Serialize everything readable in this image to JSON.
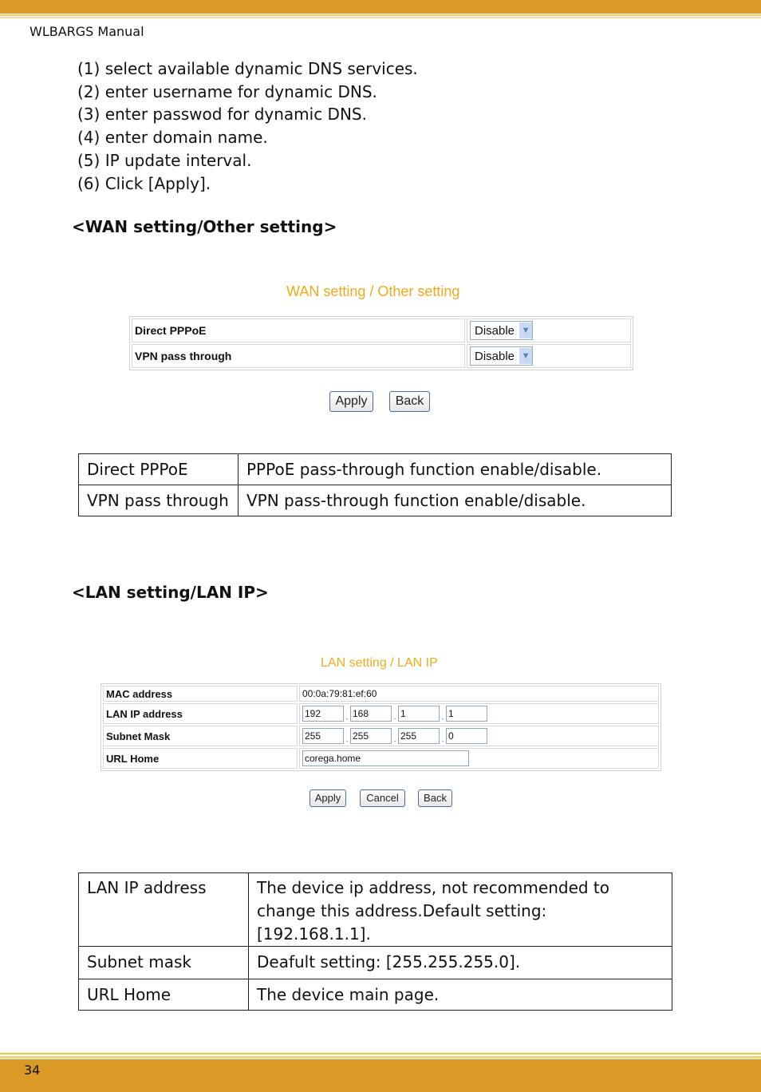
{
  "header": {
    "title": "WLBARGS Manual"
  },
  "steps": [
    "(1) select available dynamic DNS services.",
    "(2) enter username for dynamic DNS.",
    "(3) enter passwod for dynamic DNS.",
    "(4) enter domain name.",
    "(5) IP update interval.",
    "(6) Click [Apply]."
  ],
  "wan_section": {
    "heading": "<WAN setting/Other setting>",
    "screenshot": {
      "title": "WAN setting / Other setting",
      "rows": [
        {
          "label": "Direct PPPoE",
          "value": "Disable"
        },
        {
          "label": "VPN pass through",
          "value": "Disable"
        }
      ],
      "buttons": {
        "apply": "Apply",
        "back": "Back"
      }
    },
    "description_table": [
      {
        "term": "Direct PPPoE",
        "desc": "PPPoE pass-through function enable/disable."
      },
      {
        "term": "VPN pass through",
        "desc": "VPN pass-through function enable/disable."
      }
    ]
  },
  "lan_section": {
    "heading": "<LAN setting/LAN IP>",
    "screenshot": {
      "title": "LAN setting / LAN IP",
      "mac_label": "MAC address",
      "mac_value": "00:0a:79:81:ef:60",
      "ip_label": "LAN IP address",
      "ip_octets": [
        "192",
        "168",
        "1",
        "1"
      ],
      "mask_label": "Subnet Mask",
      "mask_octets": [
        "255",
        "255",
        "255",
        "0"
      ],
      "url_label": "URL Home",
      "url_value": "corega.home",
      "buttons": {
        "apply": "Apply",
        "cancel": "Cancel",
        "back": "Back"
      }
    },
    "description_table": [
      {
        "term": "LAN IP address",
        "desc_line1": "The device ip address, not recommended to",
        "desc_line2": "change this address.Default setting: [192.168.1.1]."
      },
      {
        "term": "Subnet mask",
        "desc": "Deafult setting: [255.255.255.0]."
      },
      {
        "term": "URL Home",
        "desc": "The device main page."
      }
    ]
  },
  "footer": {
    "page_number": "34"
  },
  "colors": {
    "band": "#db9a26",
    "ui_title": "#f2a91a"
  }
}
